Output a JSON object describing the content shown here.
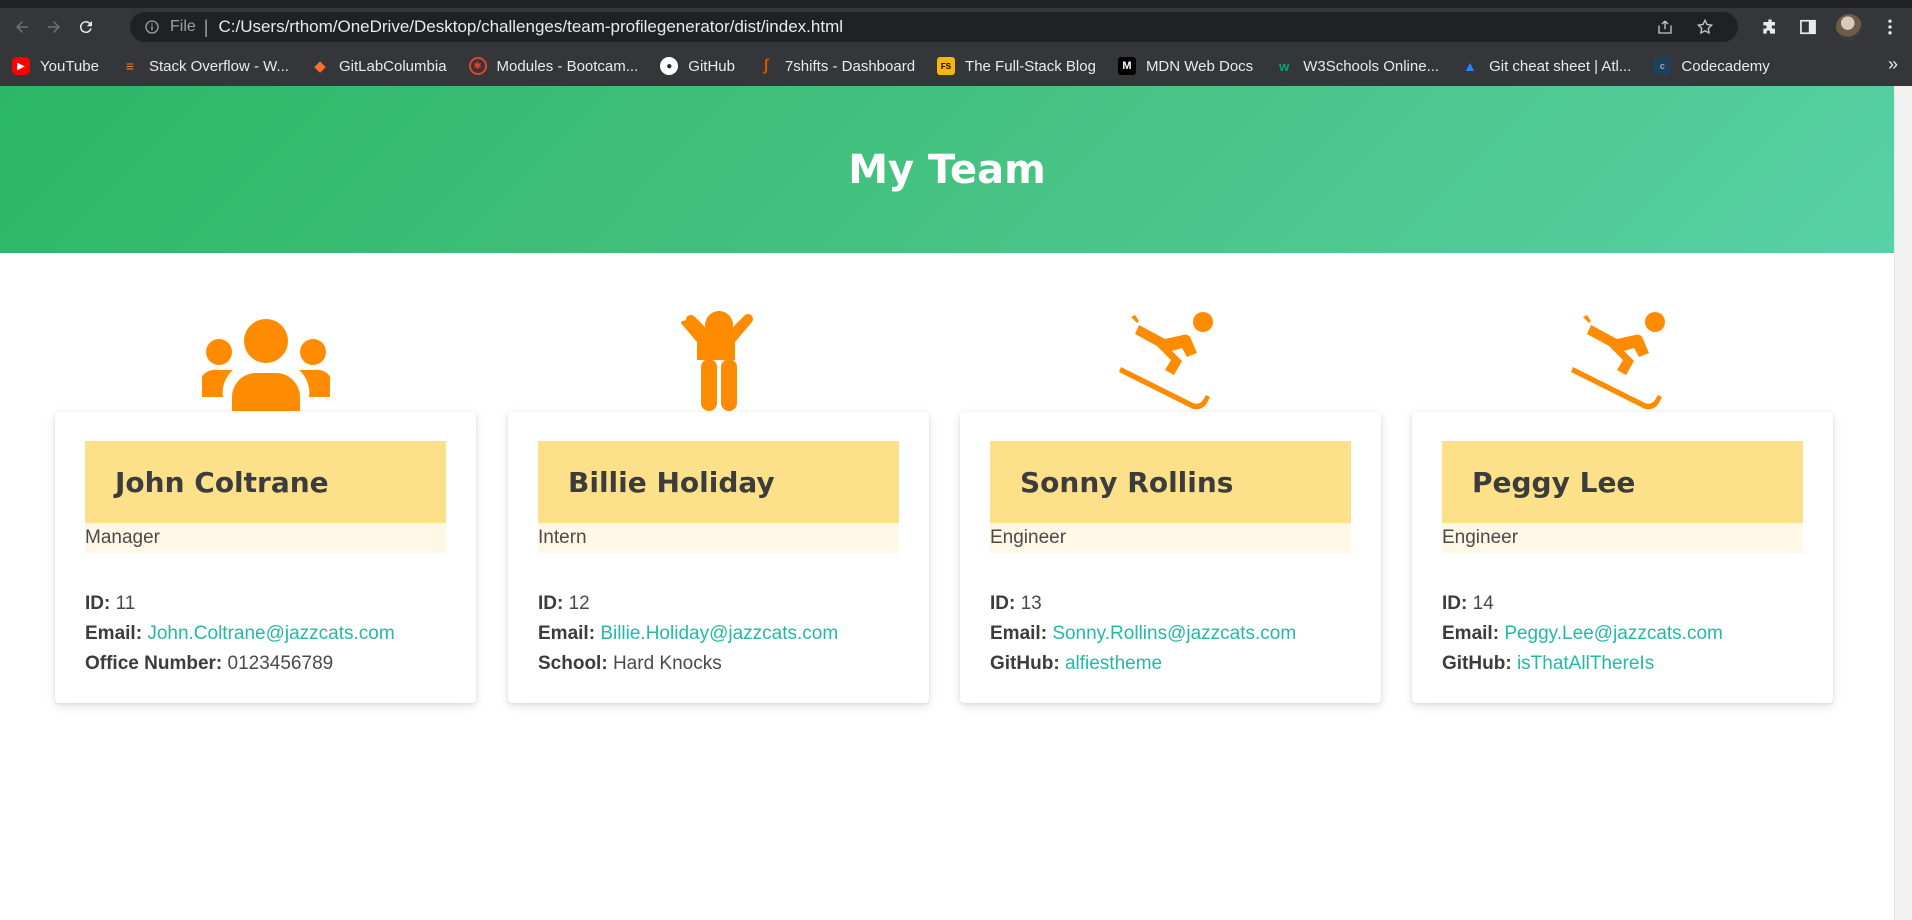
{
  "browser": {
    "scheme": "File",
    "url": "C:/Users/rthom/OneDrive/Desktop/challenges/team-profilegenerator/dist/index.html",
    "bookmarks": [
      {
        "label": "YouTube",
        "color": "#ff0000"
      },
      {
        "label": "Stack Overflow - W...",
        "color": "#f48024"
      },
      {
        "label": "GitLabColumbia",
        "color": "#fc6d26"
      },
      {
        "label": "Modules - Bootcam...",
        "color": "#e24329"
      },
      {
        "label": "GitHub",
        "color": "#ffffff"
      },
      {
        "label": "7shifts - Dashboard",
        "color": "#d35400"
      },
      {
        "label": "The Full-Stack Blog",
        "color": "#f5b700"
      },
      {
        "label": "MDN Web Docs",
        "color": "#000000"
      },
      {
        "label": "W3Schools Online...",
        "color": "#04aa6d"
      },
      {
        "label": "Git cheat sheet | Atl...",
        "color": "#2684ff"
      },
      {
        "label": "Codecademy",
        "color": "#1f4056"
      }
    ],
    "more": "»"
  },
  "page": {
    "title": "My Team",
    "accent": "#ff8c00",
    "header_color": "#fde18a",
    "link_color": "#24b8a6"
  },
  "team": [
    {
      "name": "John Coltrane",
      "role": "Manager",
      "icon": "users-icon",
      "id_label": "ID:",
      "id": "11",
      "email_label": "Email:",
      "email": "John.Coltrane@jazzcats.com",
      "extra_label": "Office Number:",
      "extra": "0123456789"
    },
    {
      "name": "Billie Holiday",
      "role": "Intern",
      "icon": "child-icon",
      "id_label": "ID:",
      "id": "12",
      "email_label": "Email:",
      "email": "Billie.Holiday@jazzcats.com",
      "extra_label": "School:",
      "extra": "Hard Knocks"
    },
    {
      "name": "Sonny Rollins",
      "role": "Engineer",
      "icon": "skiing-icon",
      "id_label": "ID:",
      "id": "13",
      "email_label": "Email:",
      "email": "Sonny.Rollins@jazzcats.com",
      "extra_label": "GitHub:",
      "extra": "alfiestheme"
    },
    {
      "name": "Peggy Lee",
      "role": "Engineer",
      "icon": "skiing-icon",
      "id_label": "ID:",
      "id": "14",
      "email_label": "Email:",
      "email": "Peggy.Lee@jazzcats.com",
      "extra_label": "GitHub:",
      "extra": "isThatAllThereIs"
    }
  ]
}
